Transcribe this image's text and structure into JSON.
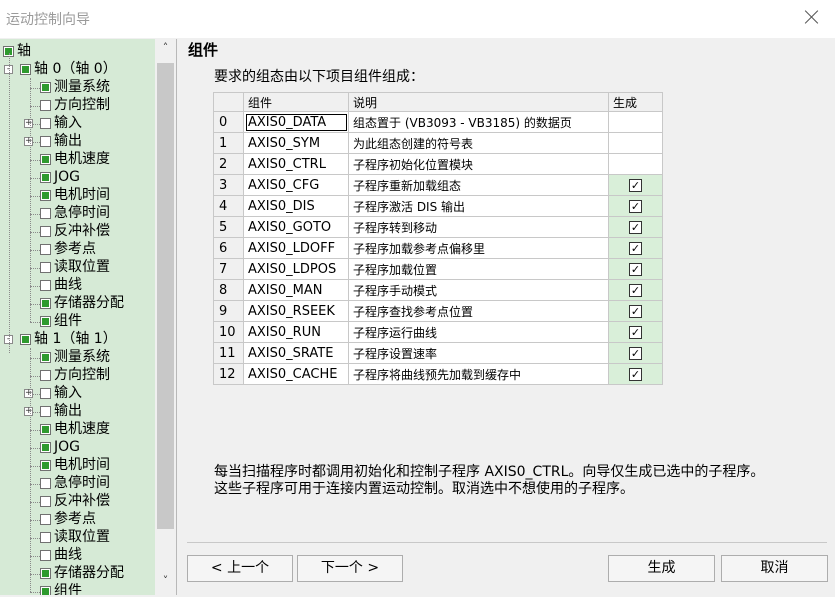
{
  "window": {
    "title": "运动控制向导"
  },
  "tree": {
    "root": "轴",
    "axes": [
      {
        "label": "轴 0（轴 0）",
        "items": [
          {
            "label": "测量系统",
            "checked": true
          },
          {
            "label": "方向控制",
            "checked": false
          },
          {
            "label": "输入",
            "checked": false,
            "expandable": true
          },
          {
            "label": "输出",
            "checked": false,
            "expandable": true
          },
          {
            "label": "电机速度",
            "checked": true
          },
          {
            "label": "JOG",
            "checked": true
          },
          {
            "label": "电机时间",
            "checked": true
          },
          {
            "label": "急停时间",
            "checked": false
          },
          {
            "label": "反冲补偿",
            "checked": false
          },
          {
            "label": "参考点",
            "checked": false
          },
          {
            "label": "读取位置",
            "checked": false
          },
          {
            "label": "曲线",
            "checked": false
          },
          {
            "label": "存储器分配",
            "checked": true
          },
          {
            "label": "组件",
            "checked": true
          }
        ]
      },
      {
        "label": "轴 1（轴 1）",
        "items": [
          {
            "label": "测量系统",
            "checked": true
          },
          {
            "label": "方向控制",
            "checked": false
          },
          {
            "label": "输入",
            "checked": false,
            "expandable": true
          },
          {
            "label": "输出",
            "checked": false,
            "expandable": true
          },
          {
            "label": "电机速度",
            "checked": true
          },
          {
            "label": "JOG",
            "checked": true
          },
          {
            "label": "电机时间",
            "checked": true
          },
          {
            "label": "急停时间",
            "checked": false
          },
          {
            "label": "反冲补偿",
            "checked": false
          },
          {
            "label": "参考点",
            "checked": false
          },
          {
            "label": "读取位置",
            "checked": false
          },
          {
            "label": "曲线",
            "checked": false
          },
          {
            "label": "存储器分配",
            "checked": true
          },
          {
            "label": "组件",
            "checked": true
          }
        ]
      }
    ]
  },
  "main": {
    "heading": "组件",
    "intro": "要求的组态由以下项目组件组成：",
    "columns": [
      "组件",
      "说明",
      "生成"
    ],
    "rows": [
      {
        "idx": "0",
        "component": "AXIS0_DATA",
        "desc": "组态置于 (VB3093 - VB3185) 的数据页",
        "gen": null
      },
      {
        "idx": "1",
        "component": "AXIS0_SYM",
        "desc": "为此组态创建的符号表",
        "gen": null
      },
      {
        "idx": "2",
        "component": "AXIS0_CTRL",
        "desc": "子程序初始化位置模块",
        "gen": null
      },
      {
        "idx": "3",
        "component": "AXIS0_CFG",
        "desc": "子程序重新加载组态",
        "gen": true
      },
      {
        "idx": "4",
        "component": "AXIS0_DIS",
        "desc": "子程序激活 DIS 输出",
        "gen": true
      },
      {
        "idx": "5",
        "component": "AXIS0_GOTO",
        "desc": "子程序转到移动",
        "gen": true
      },
      {
        "idx": "6",
        "component": "AXIS0_LDOFF",
        "desc": "子程序加载参考点偏移里",
        "gen": true
      },
      {
        "idx": "7",
        "component": "AXIS0_LDPOS",
        "desc": "子程序加载位置",
        "gen": true
      },
      {
        "idx": "8",
        "component": "AXIS0_MAN",
        "desc": "子程序手动模式",
        "gen": true
      },
      {
        "idx": "9",
        "component": "AXIS0_RSEEK",
        "desc": "子程序查找参考点位置",
        "gen": true
      },
      {
        "idx": "10",
        "component": "AXIS0_RUN",
        "desc": "子程序运行曲线",
        "gen": true
      },
      {
        "idx": "11",
        "component": "AXIS0_SRATE",
        "desc": "子程序设置速率",
        "gen": true
      },
      {
        "idx": "12",
        "component": "AXIS0_CACHE",
        "desc": "子程序将曲线预先加载到缓存中",
        "gen": true
      }
    ],
    "footer": "每当扫描程序时都调用初始化和控制子程序 AXIS0_CTRL。向导仅生成已选中的子程序。这些子程序可用于连接内置运动控制。取消选中不想使用的子程序。"
  },
  "buttons": {
    "prev": "< 上一个",
    "next": "下一个 >",
    "generate": "生成",
    "cancel": "取消"
  }
}
